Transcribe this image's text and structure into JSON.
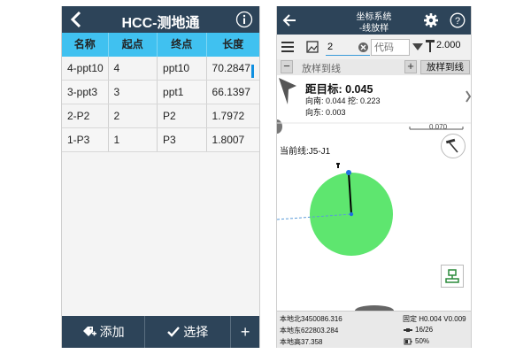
{
  "left_app": {
    "title": "HCC-测地通",
    "columns": [
      "名称",
      "起点",
      "终点",
      "长度"
    ],
    "rows": [
      {
        "name": "4-ppt10",
        "start": "4",
        "end": "ppt10",
        "length": "70.2847"
      },
      {
        "name": "3-ppt3",
        "start": "3",
        "end": "ppt1",
        "length": "66.1397"
      },
      {
        "name": "2-P2",
        "start": "2",
        "end": "P2",
        "length": "1.7972"
      },
      {
        "name": "1-P3",
        "start": "1",
        "end": "P3",
        "length": "1.8007"
      }
    ],
    "footer": {
      "add_label": "添加",
      "select_label": "选择",
      "more_label": "+"
    },
    "colors": {
      "header": "#2d4459",
      "table_header": "#40c1f0"
    }
  },
  "right_app": {
    "title_line1": "坐标系统",
    "title_line2": "-线放样",
    "toolbar": {
      "point_value": "2",
      "code_placeholder": "代码",
      "height_value": "2.000"
    },
    "stake_bar": {
      "field_placeholder": "放样到线",
      "button_label": "放样到线"
    },
    "info": {
      "distance": "距目标: 0.045",
      "direction1": "向南: 0.044 挖: 0.223",
      "direction2": "向东: 0.003",
      "current_line": "当前线:J5-J1",
      "scale": "0.070"
    },
    "status": {
      "north": "本地北3450086.316",
      "east": "本地东622803.284",
      "height": "本地高37.358",
      "fix": "固定 H0.004 V0.009",
      "sats": "16/26",
      "battery": "50%"
    },
    "colors": {
      "circle": "#5ee66f",
      "header": "#2d4459"
    }
  }
}
